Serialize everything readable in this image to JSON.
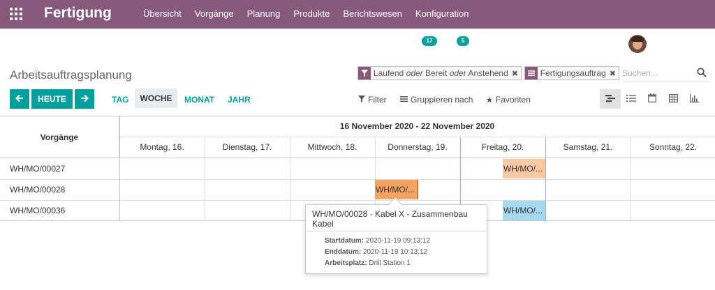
{
  "navbar": {
    "brand": "Fertigung",
    "menu": [
      "Übersicht",
      "Vorgänge",
      "Planung",
      "Produkte",
      "Berichtswesen",
      "Konfiguration"
    ],
    "badges": [
      "17",
      "5"
    ]
  },
  "page": {
    "title": "Arbeitsauftragsplanung"
  },
  "search": {
    "facet1": {
      "part1": "Laufend ",
      "or1": "oder",
      "part2": " Bereit ",
      "or2": "oder",
      "part3": " Anstehend"
    },
    "facet2": "Fertigungsauftrag",
    "placeholder": "Suchen..."
  },
  "controls": {
    "today_label": "HEUTE",
    "scales": {
      "day": "TAG",
      "week": "WOCHE",
      "month": "MONAT",
      "year": "JAHR"
    },
    "filter_label": "Filter",
    "group_label": "Gruppieren nach",
    "favorites_label": "Favoriten"
  },
  "gantt": {
    "rows_header": "Vorgänge",
    "week_title": "16 November 2020 - 22 November 2020",
    "days": [
      "Montag, 16.",
      "Dienstag, 17.",
      "Mittwoch, 18.",
      "Donnerstag, 19.",
      "Freitag, 20.",
      "Samstag, 21.",
      "Sonntag, 22."
    ],
    "rows": [
      "WH/MO/00027",
      "WH/MO/00028",
      "WH/MO/00036"
    ],
    "pills": {
      "p1": "WH/MO/...",
      "p2": "WH/MO/...",
      "p3": "WH/MO/..."
    },
    "colors": {
      "pill1": "#f8c9a5",
      "pill2": "#f4a460",
      "pill3": "#a6d8ef",
      "today": "#e6a26b"
    }
  },
  "popover": {
    "title": "WH/MO/00028 - Kabel X - Zusammenbau Kabel",
    "start_label": "Startdatum:",
    "start_value": "2020-11-19 09:13:12",
    "end_label": "Enddatum:",
    "end_value": "2020-11-19 10:13:12",
    "workcenter_label": "Arbeitsplatz:",
    "workcenter_value": "Drill Station 1"
  },
  "icons": [
    "apps-icon",
    "arrow-left-icon",
    "arrow-right-icon",
    "filter-icon",
    "list-icon",
    "star-icon",
    "search-icon",
    "gantt-view-icon",
    "list-view-icon",
    "calendar-view-icon",
    "pivot-view-icon",
    "graph-view-icon"
  ]
}
